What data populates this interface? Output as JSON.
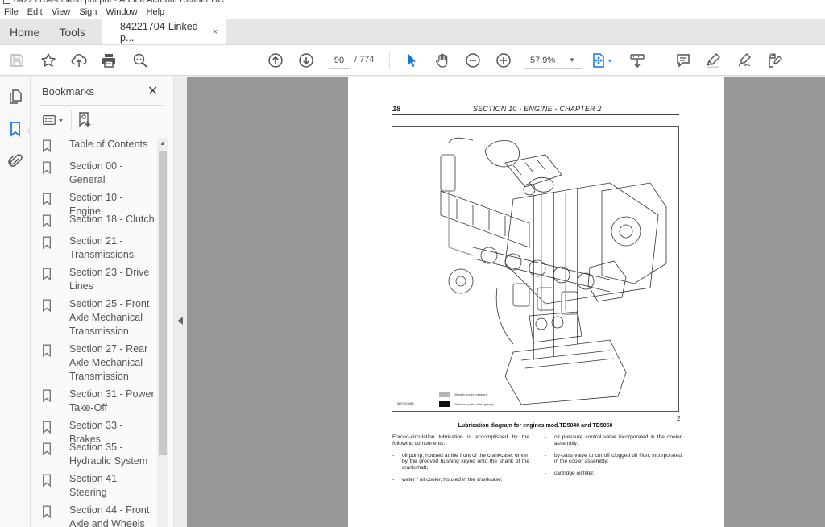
{
  "window": {
    "title": "84221704-Linked pdf.pdf - Adobe Acrobat Reader DC"
  },
  "menu": [
    "File",
    "Edit",
    "View",
    "Sign",
    "Window",
    "Help"
  ],
  "tabs": {
    "home": "Home",
    "tools": "Tools",
    "document": "84221704-Linked p...",
    "close_glyph": "×"
  },
  "toolbar": {
    "icons": [
      "save-icon",
      "bookmark-star-icon",
      "cloud-upload-icon",
      "print-icon",
      "find-icon",
      "previous-page-icon",
      "next-page-icon",
      "select-tool-icon",
      "hand-tool-icon",
      "zoom-out-icon",
      "zoom-in-icon",
      "fit-page-icon",
      "scroll-mode-icon",
      "comment-icon",
      "highlight-icon",
      "sign-icon",
      "edit-pdf-icon"
    ],
    "current_page": "90",
    "total_pages": "/ 774",
    "zoom_level": "57.9%",
    "accent_color": "#1473e6"
  },
  "rail": {
    "items": [
      "page-thumbnails-icon",
      "bookmarks-icon",
      "attachments-icon"
    ],
    "active": "bookmarks-icon"
  },
  "bookmarks_panel": {
    "title": "Bookmarks",
    "close_glyph": "✕",
    "items": [
      {
        "label": "Table of Contents"
      },
      {
        "label": "Section 00 - General"
      },
      {
        "label": "Section 10 - Engine"
      },
      {
        "label": "Section 18 - Clutch"
      },
      {
        "label": "Section 21 - Transmissions"
      },
      {
        "label": "Section 23 - Drive Lines"
      },
      {
        "label": "Section 25 - Front Axle Mechanical Transmission"
      },
      {
        "label": "Section 27 - Rear Axle Mechanical Transmission"
      },
      {
        "label": "Section 31 - Power Take-Off"
      },
      {
        "label": "Section 33 - Brakes"
      },
      {
        "label": "Section 35 - Hydraulic System"
      },
      {
        "label": "Section 41 - Steering"
      },
      {
        "label": "Section 44 - Front Axle and Wheels"
      }
    ]
  },
  "document": {
    "page_number": "18",
    "header": "SECTION 10 - ENGINE - CHAPTER 2",
    "figure": {
      "legend": [
        {
          "label": "Oil path under pressure",
          "color": "#b5b5b5"
        },
        {
          "label": "Oil return path under gravity",
          "color": "#111111"
        }
      ],
      "code": "MIF10088A",
      "number": "2",
      "caption": "Lubrication diagram for engines mod.TD5040 and TD5050"
    },
    "intro": "Forced-circulation lubrication is accomplished by the following components:",
    "left_items": [
      "oil pump, housed at the front of the crankcase, driven by the grooved bushing keyed onto the shank of the crankshaft;",
      "water / oil cooler, housed in the crankcase;"
    ],
    "right_items": [
      "oil pressure control valve incorporated in the cooler assembly;",
      "by-pass valve to cut off clogged oil filter, incorporated in the cooler assembly;",
      "cartridge oil filter."
    ],
    "dash": "-"
  }
}
